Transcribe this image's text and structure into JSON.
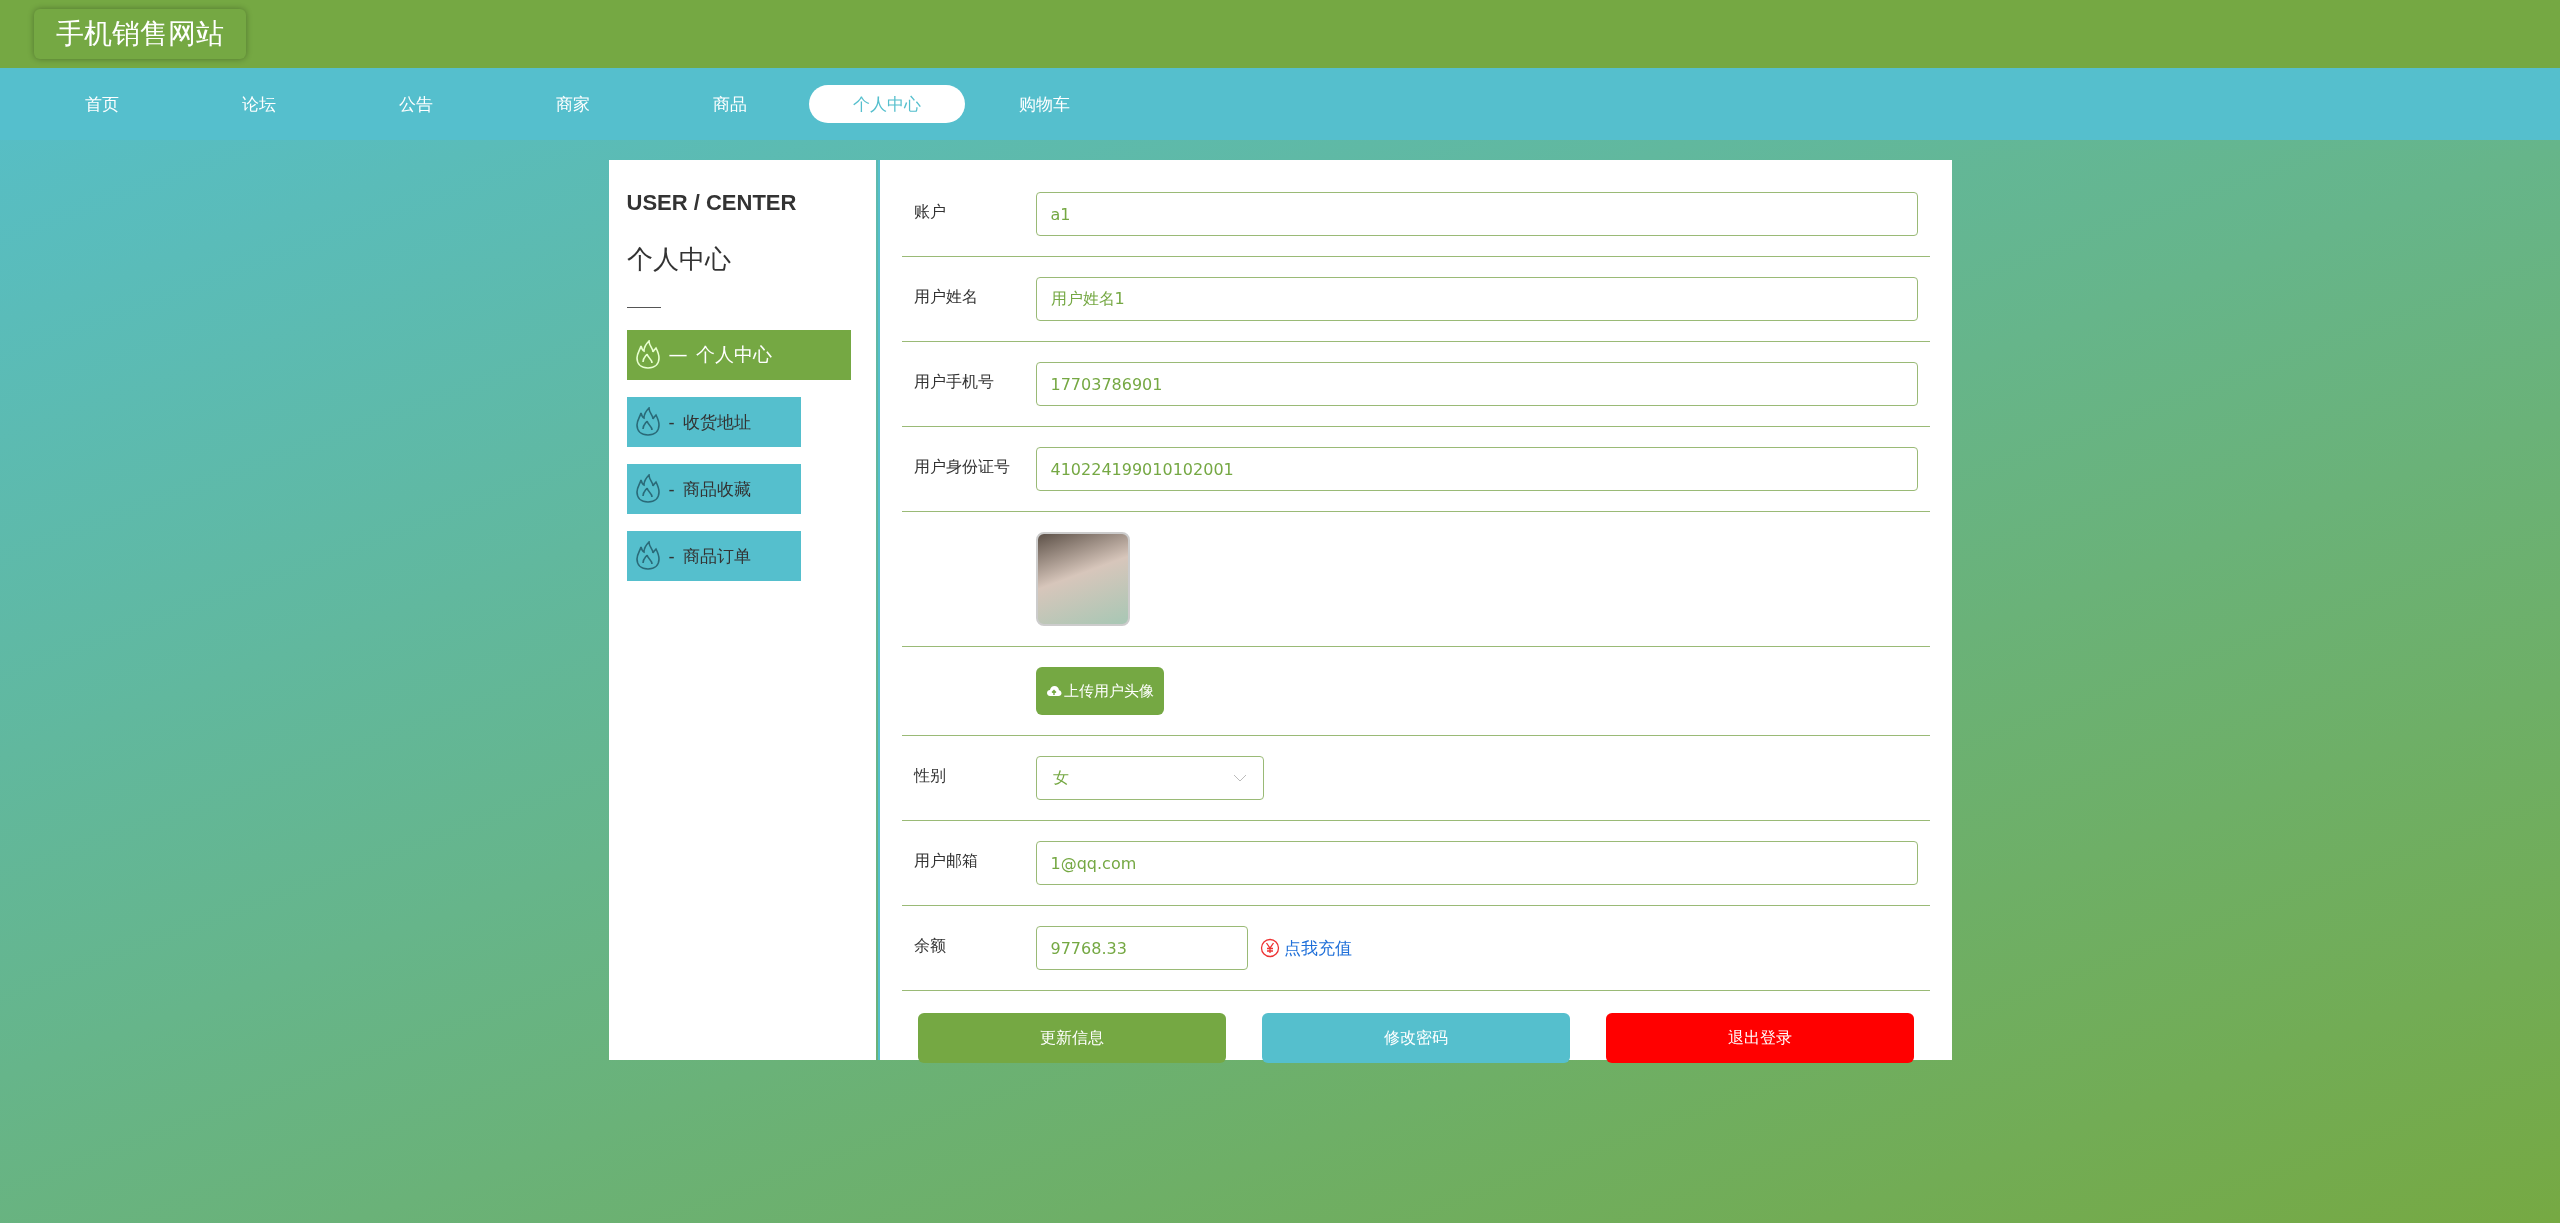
{
  "site_title": "手机销售网站",
  "nav": [
    {
      "label": "首页",
      "selected": false
    },
    {
      "label": "论坛",
      "selected": false
    },
    {
      "label": "公告",
      "selected": false
    },
    {
      "label": "商家",
      "selected": false
    },
    {
      "label": "商品",
      "selected": false
    },
    {
      "label": "个人中心",
      "selected": true
    },
    {
      "label": "购物车",
      "selected": false
    }
  ],
  "sidebar": {
    "heading_en": "USER / CENTER",
    "heading": "个人中心",
    "items": [
      {
        "label": "个人中心",
        "dash": "—",
        "selected": true
      },
      {
        "label": "收货地址",
        "dash": "-",
        "selected": false
      },
      {
        "label": "商品收藏",
        "dash": "-",
        "selected": false
      },
      {
        "label": "商品订单",
        "dash": "-",
        "selected": false
      }
    ]
  },
  "form": {
    "rows": [
      {
        "kind": "text",
        "label": "账户",
        "value": "a1"
      },
      {
        "kind": "text",
        "label": "用户姓名",
        "value": "用户姓名1"
      },
      {
        "kind": "text",
        "label": "用户手机号",
        "value": "17703786901"
      },
      {
        "kind": "text",
        "label": "用户身份证号",
        "value": "410224199010102001"
      },
      {
        "kind": "image"
      },
      {
        "kind": "upload",
        "button": "上传用户头像"
      },
      {
        "kind": "select",
        "label": "性别",
        "value": "女"
      },
      {
        "kind": "text",
        "label": "用户邮箱",
        "value": "1@qq.com"
      },
      {
        "kind": "balance",
        "label": "余额",
        "value": "97768.33",
        "link": "点我充值"
      }
    ],
    "buttons": [
      {
        "label": "更新信息",
        "kind": "primary"
      },
      {
        "label": "修改密码",
        "kind": "secondary"
      },
      {
        "label": "退出登录",
        "kind": "danger"
      }
    ]
  }
}
